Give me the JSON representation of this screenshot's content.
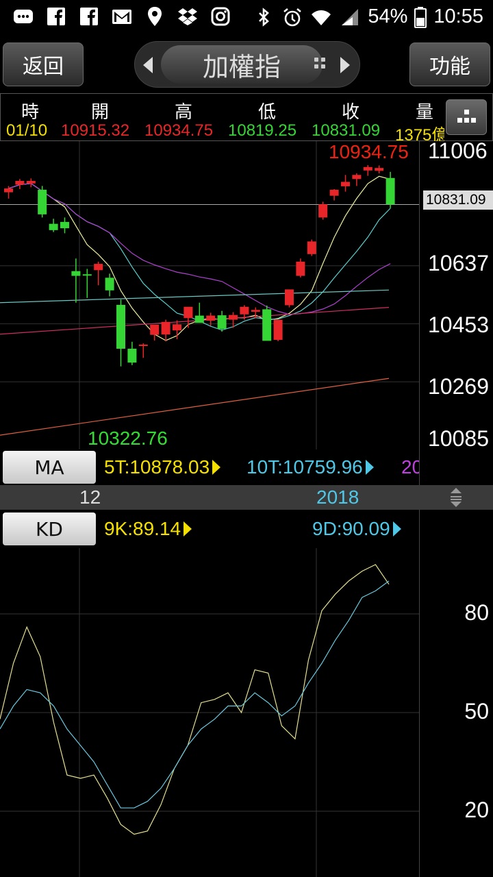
{
  "status_bar": {
    "icons": [
      "message-icon",
      "facebook-icon",
      "facebook-icon",
      "gmail-icon",
      "location-icon",
      "dropbox-icon",
      "instagram-icon"
    ],
    "right_icons": [
      "bluetooth-icon",
      "alarm-icon",
      "wifi-icon",
      "signal-icon"
    ],
    "battery": "54%",
    "time": "10:55"
  },
  "header": {
    "back_label": "返回",
    "title": "加權指",
    "function_label": "功能"
  },
  "info": {
    "headers": [
      "時",
      "開",
      "高",
      "低",
      "收",
      "量"
    ],
    "values": [
      "01/10",
      "10915.32",
      "10934.75",
      "10819.25",
      "10831.09",
      "1375億"
    ],
    "value_colors": [
      "#f5e000",
      "#e8262a",
      "#e8262a",
      "#36d536",
      "#36d536",
      "#f5e000"
    ]
  },
  "price_chart": {
    "axis_labels": [
      "11006",
      "10637",
      "10453",
      "10269",
      "10085"
    ],
    "current_price": "10831.09",
    "high_label": "10934.75",
    "low_label": "10322.76"
  },
  "ma": {
    "button_label": "MA",
    "ma5": "5T:10878.03",
    "ma10": "10T:10759.96",
    "ma20": "20"
  },
  "date_strip": {
    "left": "12",
    "right": "2018"
  },
  "kd": {
    "button_label": "KD",
    "k_value": "9K:89.14",
    "d_value": "9D:90.09",
    "axis_labels": [
      "80",
      "50",
      "20"
    ]
  },
  "colors": {
    "up": "#e8262a",
    "down": "#36d536",
    "ma5": "#f0f0a0",
    "ma10": "#5ad0d0",
    "ma20": "#b040d0",
    "ma60": "#d03060",
    "ma120": "#e06040",
    "k_line": "#e6e090",
    "d_line": "#6ac8e0"
  },
  "chart_data": {
    "type": "candlestick",
    "y_axis_ticks": [
      11006,
      10637,
      10453,
      10269,
      10085
    ],
    "candles": [
      {
        "o": 10870,
        "h": 10890,
        "l": 10850,
        "c": 10882
      },
      {
        "o": 10894,
        "h": 10912,
        "l": 10880,
        "c": 10906
      },
      {
        "o": 10898,
        "h": 10914,
        "l": 10886,
        "c": 10906
      },
      {
        "o": 10878,
        "h": 10890,
        "l": 10790,
        "c": 10800
      },
      {
        "o": 10770,
        "h": 10786,
        "l": 10744,
        "c": 10750
      },
      {
        "o": 10776,
        "h": 10790,
        "l": 10740,
        "c": 10756
      },
      {
        "o": 10620,
        "h": 10660,
        "l": 10520,
        "c": 10605
      },
      {
        "o": 10610,
        "h": 10627,
        "l": 10535,
        "c": 10608
      },
      {
        "o": 10623,
        "h": 10650,
        "l": 10575,
        "c": 10643
      },
      {
        "o": 10599,
        "h": 10612,
        "l": 10540,
        "c": 10559
      },
      {
        "o": 10513,
        "h": 10530,
        "l": 10318,
        "c": 10374
      },
      {
        "o": 10374,
        "h": 10396,
        "l": 10322,
        "c": 10330
      },
      {
        "o": 10383,
        "h": 10391,
        "l": 10345,
        "c": 10387
      },
      {
        "o": 10418,
        "h": 10450,
        "l": 10400,
        "c": 10450
      },
      {
        "o": 10419,
        "h": 10466,
        "l": 10397,
        "c": 10459
      },
      {
        "o": 10432,
        "h": 10464,
        "l": 10404,
        "c": 10451
      },
      {
        "o": 10471,
        "h": 10502,
        "l": 10440,
        "c": 10507
      },
      {
        "o": 10479,
        "h": 10520,
        "l": 10457,
        "c": 10456
      },
      {
        "o": 10463,
        "h": 10488,
        "l": 10447,
        "c": 10479
      },
      {
        "o": 10480,
        "h": 10494,
        "l": 10428,
        "c": 10437
      },
      {
        "o": 10466,
        "h": 10490,
        "l": 10440,
        "c": 10481
      },
      {
        "o": 10483,
        "h": 10512,
        "l": 10466,
        "c": 10507
      },
      {
        "o": 10491,
        "h": 10505,
        "l": 10470,
        "c": 10497
      },
      {
        "o": 10499,
        "h": 10511,
        "l": 10414,
        "c": 10399
      },
      {
        "o": 10402,
        "h": 10460,
        "l": 10398,
        "c": 10466
      },
      {
        "o": 10512,
        "h": 10560,
        "l": 10505,
        "c": 10562
      },
      {
        "o": 10605,
        "h": 10660,
        "l": 10600,
        "c": 10650
      },
      {
        "o": 10674,
        "h": 10720,
        "l": 10668,
        "c": 10714
      },
      {
        "o": 10790,
        "h": 10840,
        "l": 10783,
        "c": 10832
      },
      {
        "o": 10859,
        "h": 10880,
        "l": 10844,
        "c": 10878
      },
      {
        "o": 10889,
        "h": 10925,
        "l": 10872,
        "c": 10903
      },
      {
        "o": 10912,
        "h": 10930,
        "l": 10890,
        "c": 10925
      },
      {
        "o": 10939,
        "h": 10956,
        "l": 10922,
        "c": 10950
      },
      {
        "o": 10938,
        "h": 10955,
        "l": 10930,
        "c": 10947
      },
      {
        "o": 10915.32,
        "h": 10934.75,
        "l": 10819.25,
        "c": 10831.09
      }
    ],
    "kd": {
      "y_axis_ticks": [
        80,
        50,
        20
      ],
      "k": [
        48,
        65,
        76,
        67,
        47,
        31,
        30,
        31,
        24,
        16,
        13,
        14,
        22,
        33,
        40,
        53,
        54,
        56,
        50,
        63,
        62,
        46,
        42,
        66,
        81,
        86,
        90,
        93,
        95,
        89
      ],
      "d": [
        45,
        52,
        57,
        56,
        52,
        45,
        40,
        35,
        28,
        21,
        21,
        23,
        27,
        33,
        40,
        45,
        48,
        52,
        52,
        56,
        53,
        49,
        52,
        59,
        65,
        72,
        78,
        85,
        87,
        90
      ]
    }
  }
}
